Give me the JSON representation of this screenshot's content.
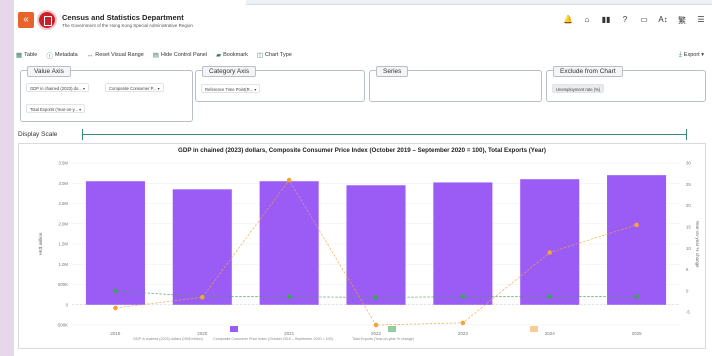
{
  "header": {
    "dept_name": "Census and Statistics Department",
    "dept_sub": "The Government of the Hong Kong Special Administrative Region",
    "icons": [
      "bell-icon",
      "home-icon",
      "book-icon",
      "help-icon",
      "document-icon",
      "font-size-icon",
      "chinese-language-icon",
      "menu-icon"
    ],
    "icon_glyphs": [
      "🔔",
      "⌂",
      "▮▮",
      "?",
      "▭",
      "A↕",
      "繁",
      "☰"
    ]
  },
  "toolbar": {
    "table": "Table",
    "metadata": "Metadata",
    "reset": "Reset Visual Range",
    "hide_control": "Hide Control Panel",
    "bookmark": "Bookmark",
    "chart_type": "Chart Type",
    "export": "Export"
  },
  "panels": {
    "value_axis": {
      "title": "Value Axis",
      "chips": [
        "GDP in chained (2023) do... ▾",
        "Composite Consumer P... ▾",
        "Total Exports (Year-on-y... ▾"
      ]
    },
    "category_axis": {
      "title": "Category Axis",
      "chips": [
        "Reference Time Point(R... ▾"
      ]
    },
    "series": {
      "title": "Series"
    },
    "exclude": {
      "title": "Exclude from Chart",
      "chips": [
        "Unemployment rate (%)"
      ]
    }
  },
  "display_scale": "Display Scale",
  "chart_data": {
    "type": "bar",
    "title": "GDP in chained (2023) dollars, Composite Consumer Price Index (October 2019 – September 2020 = 100), Total Exports (Year)",
    "ylabel_left": "HK$ million",
    "ylabel_right": "Year-on-year % change",
    "categories": [
      "2019",
      "2020",
      "2021",
      "2022",
      "2023",
      "2024",
      "2025"
    ],
    "left_ticks": [
      "-500K",
      "0",
      "500K",
      "1.0M",
      "1.5M",
      "2.0M",
      "2.5M",
      "3.0M",
      "3.5M"
    ],
    "right_ticks": [
      "-5",
      "0",
      "5",
      "10",
      "15",
      "20",
      "25",
      "30"
    ],
    "ylim_left": [
      -500000,
      3500000
    ],
    "ylim_right": [
      -8,
      30
    ],
    "series": [
      {
        "name": "GDP in chained (2023) dollars (HK$ million)",
        "axis": "left",
        "kind": "bar",
        "color": "#9b5cf6",
        "values": [
          3050000,
          2850000,
          3050000,
          2950000,
          3020000,
          3100000,
          3200000
        ]
      },
      {
        "name": "Composite Consumer Price Index (October 2019 – September 2020 = 100)",
        "axis": "left",
        "kind": "line",
        "color": "#3aa655",
        "values": [
          340000,
          200000,
          200000,
          180000,
          200000,
          200000,
          200000
        ]
      },
      {
        "name": "Total Exports (Year-on-year % change)",
        "axis": "right",
        "kind": "line",
        "color": "#f2a33a",
        "values": [
          -4.0,
          -1.5,
          26.0,
          -8.0,
          -7.5,
          9.0,
          15.5
        ]
      }
    ],
    "legend_position": "bottom"
  }
}
